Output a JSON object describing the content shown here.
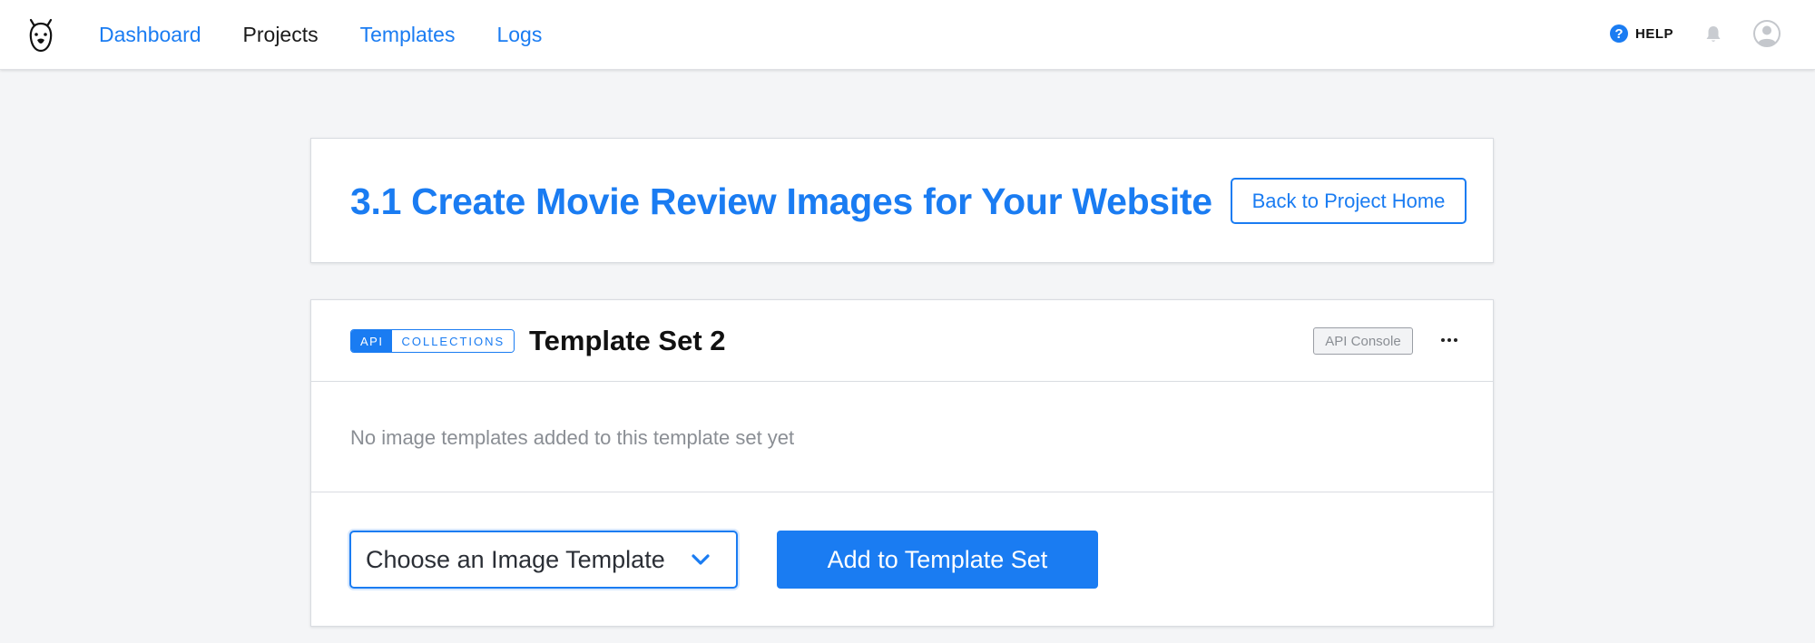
{
  "nav": {
    "items": [
      {
        "label": "Dashboard",
        "active": false
      },
      {
        "label": "Projects",
        "active": true
      },
      {
        "label": "Templates",
        "active": false
      },
      {
        "label": "Logs",
        "active": false
      }
    ],
    "help_label": "HELP",
    "help_glyph": "?",
    "logo_icon": "bear-logo-icon",
    "bell_icon": "bell-icon",
    "avatar_icon": "user-avatar-icon"
  },
  "project": {
    "title": "3.1 Create Movie Review Images for Your Website",
    "back_label": "Back to Project Home"
  },
  "template_set": {
    "tag_api": "API",
    "tag_collections": "COLLECTIONS",
    "name": "Template Set 2",
    "api_console_label": "API Console",
    "empty_message": "No image templates added to this template set yet",
    "select_label": "Choose an Image Template",
    "add_label": "Add to Template Set"
  },
  "colors": {
    "accent": "#1a7cf2",
    "background": "#f4f5f7",
    "muted_text": "#8a8e94"
  }
}
